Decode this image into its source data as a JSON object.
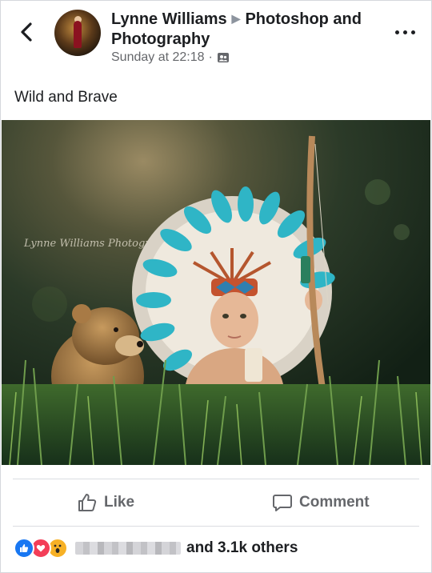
{
  "post": {
    "author": "Lynne Williams",
    "group": "Photoshop and Photography",
    "timestamp": "Sunday at 22:18",
    "separator": "·",
    "audience_icon": "group-audience-icon",
    "caption": "Wild and Brave",
    "image_watermark": "Lynne Williams Photography"
  },
  "actions": {
    "like_label": "Like",
    "comment_label": "Comment"
  },
  "reactions": {
    "types": [
      "like",
      "love",
      "wow"
    ],
    "summary": "and 3.1k others"
  },
  "icons": {
    "back": "back-chevron-icon",
    "more": "more-options-icon",
    "like": "thumbs-up-icon",
    "comment": "comment-bubble-icon"
  },
  "colors": {
    "text_primary": "#1c1e21",
    "text_secondary": "#65676b",
    "like_blue": "#1877f2",
    "love_red": "#f33e58",
    "wow_yellow": "#f7b125"
  }
}
